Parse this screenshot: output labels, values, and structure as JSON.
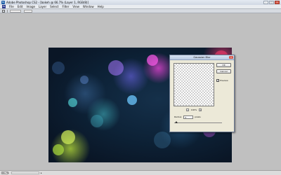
{
  "app": {
    "title": "Adobe Photoshop CS2 - [bokeh @ 66.7% (Layer 1, RGB/8)]",
    "icon": "photoshop-icon",
    "icon_text": "Ps"
  },
  "window_buttons": {
    "minimize": "–",
    "maximize": "□",
    "close": "×"
  },
  "menu": {
    "logo_text": "Ps",
    "items": [
      "File",
      "Edit",
      "Image",
      "Layer",
      "Select",
      "Filter",
      "View",
      "Window",
      "Help"
    ]
  },
  "dialog": {
    "title": "Gaussian Blur",
    "close_label": "×",
    "ok_label": "OK",
    "cancel_label": "Cancel",
    "preview_label": "Preview",
    "preview_checked": true,
    "check_mark": "✓",
    "zoom_minus": "−",
    "zoom_plus": "+",
    "zoom_level": "100%",
    "radius_label": "Radius:",
    "radius_value": "3",
    "radius_unit": "pixels",
    "slider_fraction": 0.04
  },
  "status": {
    "zoom": "66.7%",
    "arrow": "▸"
  },
  "colors": {
    "canvas_bg": "#0d2237",
    "workspace_bg": "#c0c0c0",
    "dialog_bg": "#ece9d8"
  }
}
